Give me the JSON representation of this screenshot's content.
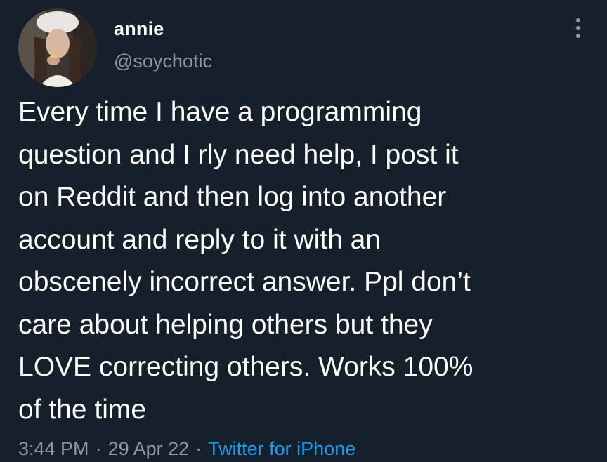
{
  "user": {
    "display_name": "annie",
    "handle": "@soychotic",
    "avatar_icon": "profile-photo"
  },
  "tweet": {
    "text": "Every time I have a programming\nquestion and I rly need help, I post it\non Reddit and then log into another\naccount and reply to it with an\nobscenely incorrect answer. Ppl don’t\ncare about helping others but they\nLOVE correcting others. Works 100%\nof the time"
  },
  "meta": {
    "time": "3:44 PM",
    "separator": "·",
    "date": "29 Apr 22",
    "source": "Twitter for iPhone"
  },
  "colors": {
    "background": "#15202b",
    "text": "#ffffff",
    "secondary": "#8b98a5",
    "link": "#1d9bf0"
  },
  "icons": {
    "more": "more-vertical-icon"
  }
}
